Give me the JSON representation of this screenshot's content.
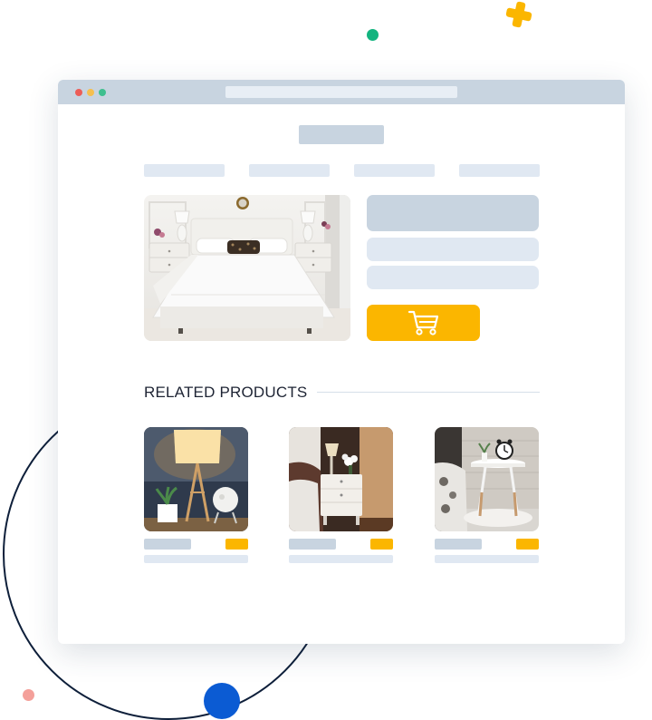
{
  "related": {
    "heading": "RELATED PRODUCTS",
    "products": [
      {
        "image": "table-lamp-photo"
      },
      {
        "image": "nightstand-with-lamp-photo"
      },
      {
        "image": "round-side-table-with-clock-photo"
      }
    ]
  },
  "hero": {
    "image": "white-bedroom-photo"
  },
  "icons": {
    "cart": "shopping-cart-icon",
    "plus": "plus-shape"
  },
  "colors": {
    "accent": "#fbb600",
    "placeholder_dark": "#c8d4e0",
    "placeholder_light": "#e0e8f2",
    "decor_blue": "#0b5bd3",
    "decor_green": "#13b47f",
    "decor_pink": "#f4a09a",
    "decor_circle": "#0e1f3a"
  }
}
